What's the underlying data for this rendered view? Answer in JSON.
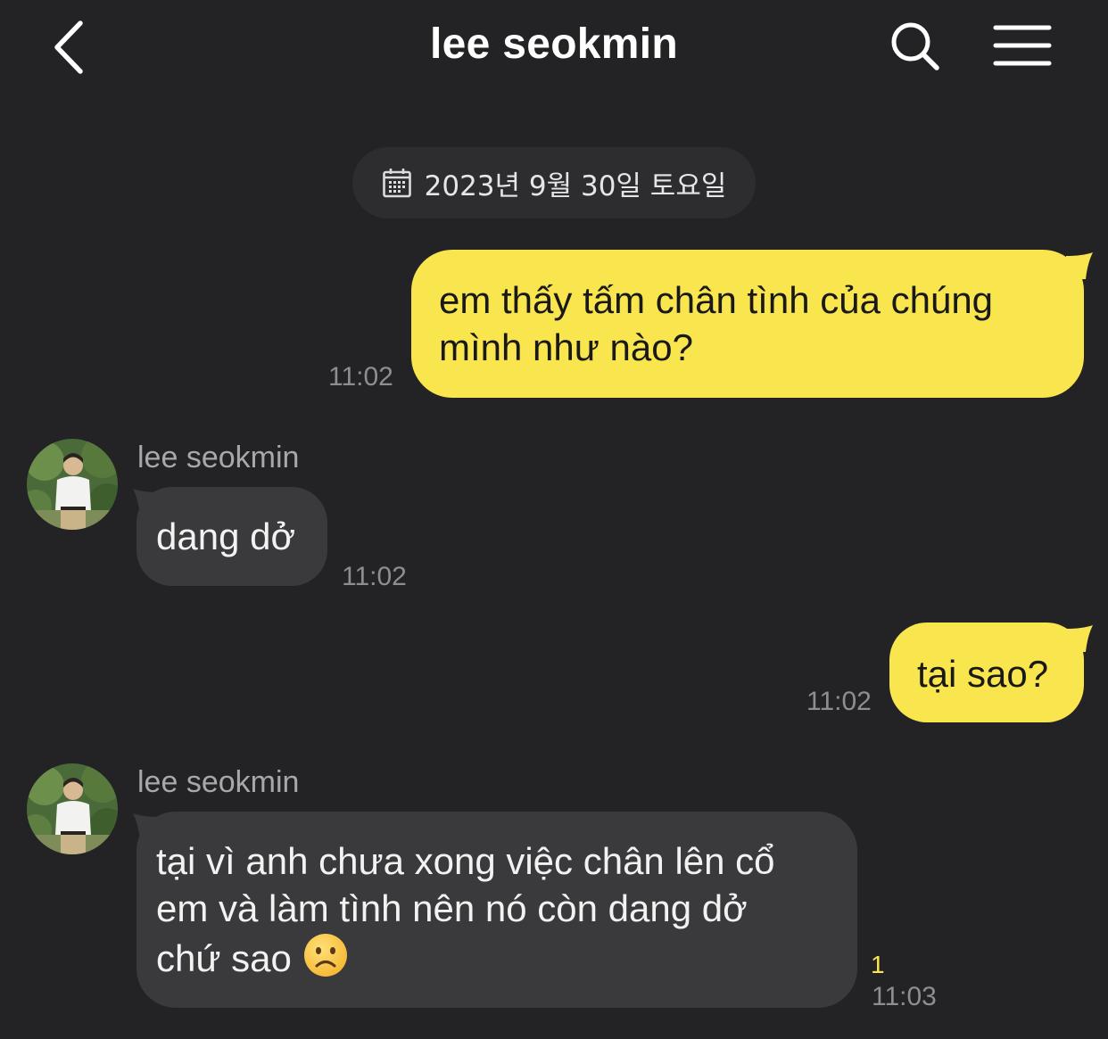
{
  "header": {
    "title": "lee seokmin",
    "back_icon": "chevron-left-icon",
    "search_icon": "search-icon",
    "menu_icon": "hamburger-menu-icon"
  },
  "date_divider": {
    "label": "2023년 9월 30일 토요일",
    "icon": "calendar-icon"
  },
  "messages": [
    {
      "sender": "me",
      "lines": [
        "em thấy tấm chân tình của chúng",
        "mình như nào?"
      ],
      "time": "11:02"
    },
    {
      "sender": "them",
      "name": "lee seokmin",
      "lines": [
        "dang dở"
      ],
      "time": "11:02"
    },
    {
      "sender": "me",
      "lines": [
        "tại sao?"
      ],
      "time": "11:02"
    },
    {
      "sender": "them",
      "name": "lee seokmin",
      "lines": [
        "tại vì anh chưa xong việc chân lên cổ",
        "em và làm tình nên nó còn dang dở",
        "chứ sao"
      ],
      "emoji": "frowning-face-icon",
      "time": "11:03",
      "unread_count": "1"
    }
  ],
  "colors": {
    "background": "#232325",
    "my_bubble": "#f9e54e",
    "their_bubble": "#3a3a3c",
    "timestamp": "#8e8e92",
    "unread": "#f9e54e"
  }
}
